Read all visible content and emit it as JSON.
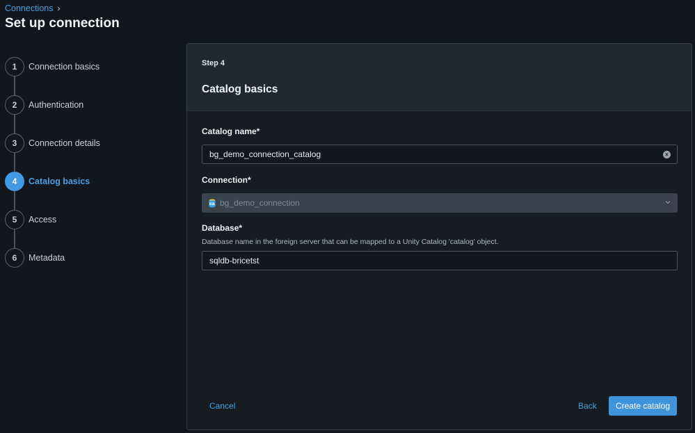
{
  "breadcrumb": {
    "parent": "Connections",
    "separator": "›"
  },
  "page": {
    "title": "Set up connection"
  },
  "stepper": {
    "steps": [
      {
        "number": "1",
        "label": "Connection basics"
      },
      {
        "number": "2",
        "label": "Authentication"
      },
      {
        "number": "3",
        "label": "Connection details"
      },
      {
        "number": "4",
        "label": "Catalog basics",
        "active": true
      },
      {
        "number": "5",
        "label": "Access"
      },
      {
        "number": "6",
        "label": "Metadata"
      }
    ]
  },
  "panel": {
    "step_label": "Step 4",
    "title": "Catalog basics",
    "catalog_name": {
      "label": "Catalog name*",
      "value": "bg_demo_connection_catalog"
    },
    "connection": {
      "label": "Connection*",
      "value": "bg_demo_connection",
      "icon": "sql-database-icon"
    },
    "database": {
      "label": "Database*",
      "hint": "Database name in the foreign server that can be mapped to a Unity Catalog 'catalog' object.",
      "value": "sqldb-bricetst"
    },
    "actions": {
      "cancel": "Cancel",
      "back": "Back",
      "create": "Create catalog"
    }
  },
  "colors": {
    "accent": "#4299e1",
    "background": "#11171c",
    "panel": "#161c22"
  }
}
